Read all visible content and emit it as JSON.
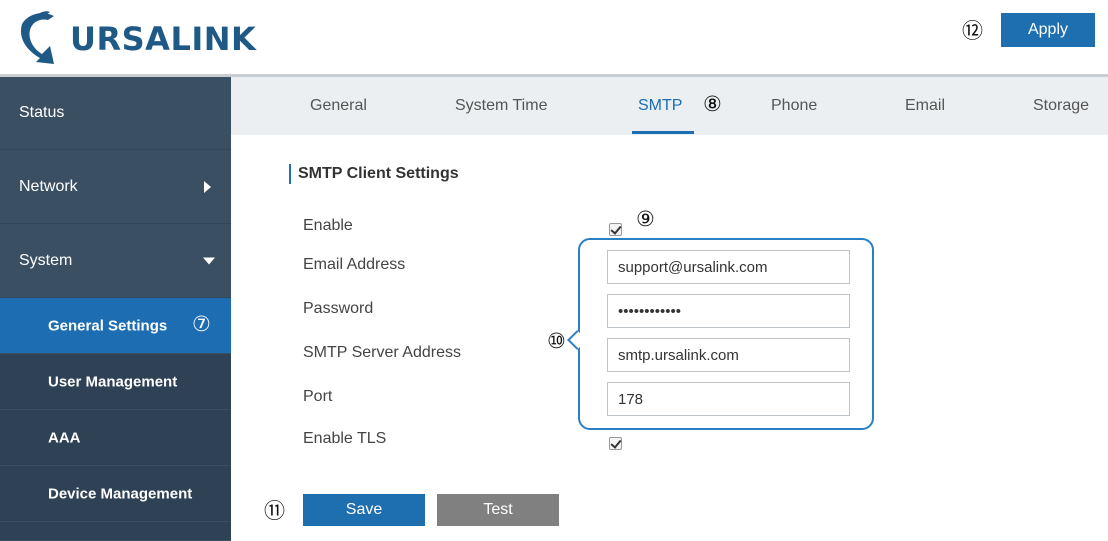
{
  "header": {
    "logo_text": "URSALINK",
    "apply_label": "Apply",
    "callout_apply": "⑫"
  },
  "sidebar": {
    "items": [
      {
        "label": "Status"
      },
      {
        "label": "Network"
      },
      {
        "label": "System"
      }
    ],
    "sub_items": [
      {
        "label": "General Settings",
        "callout": "⑦"
      },
      {
        "label": "User Management"
      },
      {
        "label": "AAA"
      },
      {
        "label": "Device Management"
      }
    ]
  },
  "tabs": [
    {
      "label": "General"
    },
    {
      "label": "System Time"
    },
    {
      "label": "SMTP",
      "callout": "⑧"
    },
    {
      "label": "Phone"
    },
    {
      "label": "Email"
    },
    {
      "label": "Storage"
    }
  ],
  "form": {
    "title": "SMTP Client Settings",
    "enable_label": "Enable",
    "enable_checked": true,
    "callout_enable": "⑨",
    "email_label": "Email Address",
    "email_value": "support@ursalink.com",
    "password_label": "Password",
    "password_value": "••••••••••••",
    "server_label": "SMTP Server Address",
    "server_value": "smtp.ursalink.com",
    "port_label": "Port",
    "port_value": "178",
    "callout_fields": "⑩",
    "tls_label": "Enable TLS",
    "tls_checked": true,
    "save_label": "Save",
    "test_label": "Test",
    "callout_buttons": "⑪"
  },
  "colors": {
    "accent": "#1d6db2",
    "sidebar": "#3b4f63",
    "sidebar_sub": "#2f4255",
    "test_button": "#808080"
  }
}
